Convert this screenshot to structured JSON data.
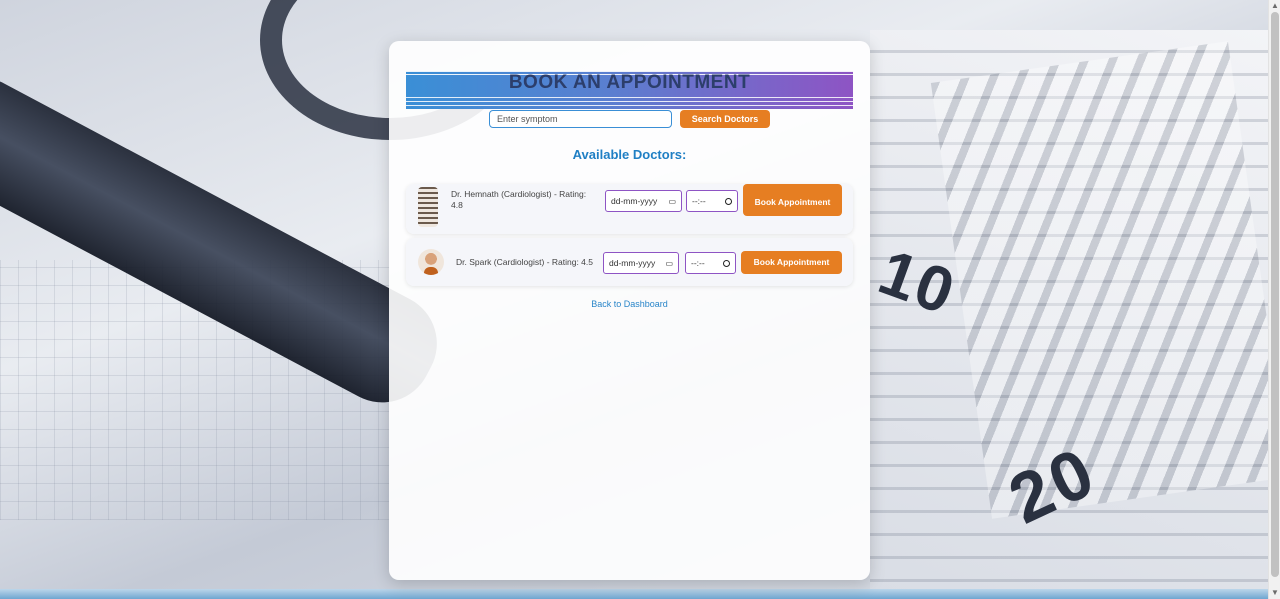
{
  "page": {
    "title": "BOOK AN APPOINTMENT",
    "search": {
      "placeholder": "Enter symptom",
      "button_label": "Search Doctors"
    },
    "section_title": "Available Doctors:",
    "doctors": [
      {
        "label": "Dr. Hemnath (Cardiologist) - Rating: 4.8",
        "date_placeholder": "dd-mm-yyyy",
        "time_placeholder": "--:--",
        "book_label": "Book Appointment"
      },
      {
        "label": "Dr. Spark (Cardiologist) - Rating: 4.5",
        "date_placeholder": "dd-mm-yyyy",
        "time_placeholder": "--:--",
        "book_label": "Book Appointment"
      }
    ],
    "back_link": "Back to Dashboard"
  },
  "background": {
    "label_10": "10",
    "label_20": "20"
  },
  "colors": {
    "accent_orange": "#e67e22",
    "title_blue": "#1f7fc4",
    "gradient_start": "#3a8fd6",
    "gradient_end": "#8e54c4"
  }
}
